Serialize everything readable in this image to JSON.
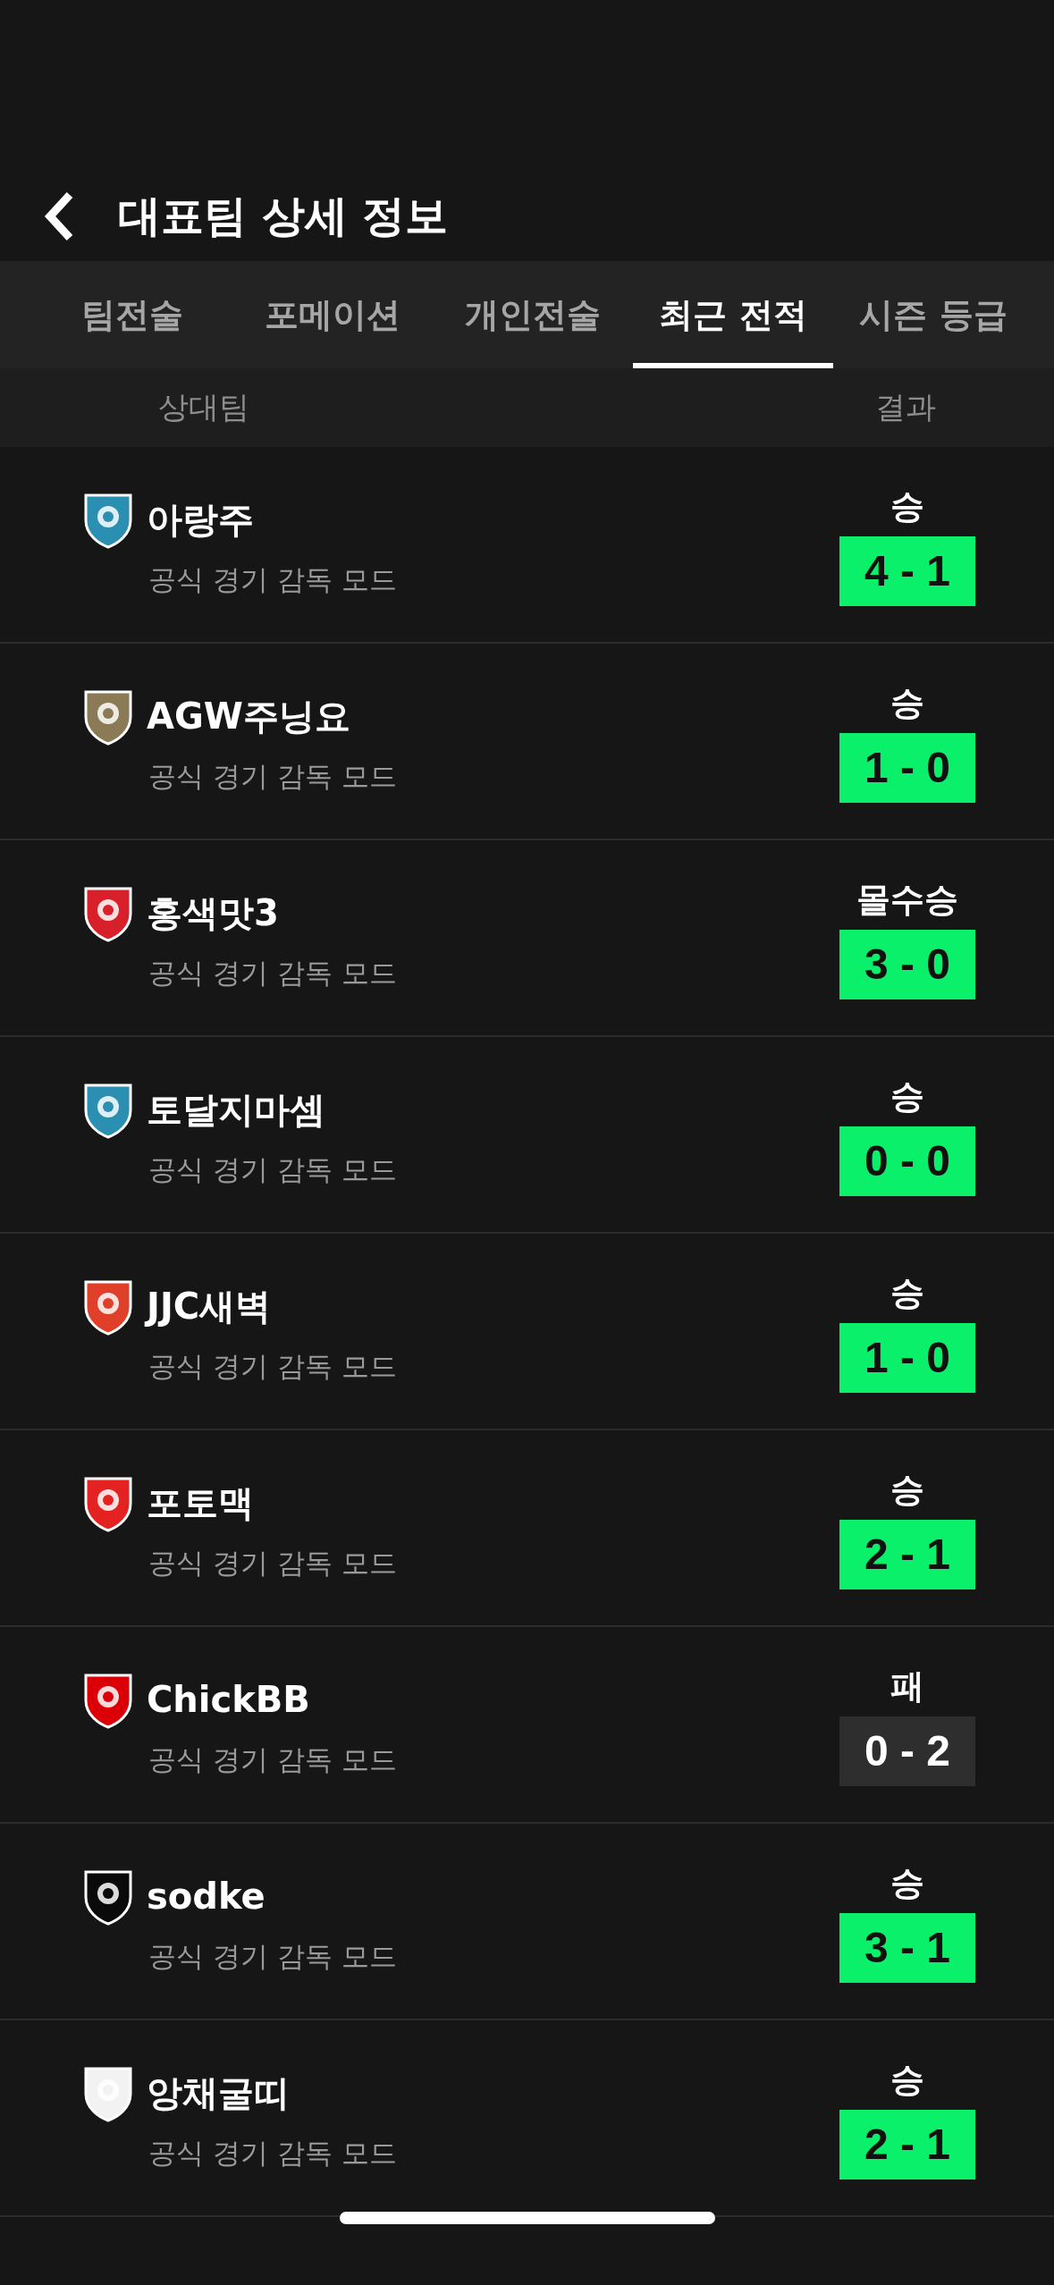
{
  "header": {
    "title": "대표팀 상세 정보"
  },
  "tabs": [
    {
      "label": "팀전술",
      "selected": false
    },
    {
      "label": "포메이션",
      "selected": false
    },
    {
      "label": "개인전술",
      "selected": false
    },
    {
      "label": "최근 전적",
      "selected": true
    },
    {
      "label": "시즌 등급",
      "selected": false
    }
  ],
  "columns": [
    "상대팀",
    "결과"
  ],
  "matches": [
    {
      "team": "아랑주",
      "mode": "공식 경기 감독 모드",
      "result": "승",
      "score": "4 - 1",
      "won": true,
      "color": "#2a8fb0"
    },
    {
      "team": "AGW주닝요",
      "mode": "공식 경기 감독 모드",
      "result": "승",
      "score": "1 - 0",
      "won": true,
      "color": "#8a7a55"
    },
    {
      "team": "홍색맛3",
      "mode": "공식 경기 감독 모드",
      "result": "몰수승",
      "score": "3 - 0",
      "won": true,
      "color": "#d8202a"
    },
    {
      "team": "토달지마셈",
      "mode": "공식 경기 감독 모드",
      "result": "승",
      "score": "0 - 0",
      "won": true,
      "color": "#2a8fb0"
    },
    {
      "team": "JJC새벽",
      "mode": "공식 경기 감독 모드",
      "result": "승",
      "score": "1 - 0",
      "won": true,
      "color": "#e0402a"
    },
    {
      "team": "포토맥",
      "mode": "공식 경기 감독 모드",
      "result": "승",
      "score": "2 - 1",
      "won": true,
      "color": "#e32221"
    },
    {
      "team": "ChickBB",
      "mode": "공식 경기 감독 모드",
      "result": "패",
      "score": "0 - 2",
      "won": false,
      "color": "#db0007"
    },
    {
      "team": "sodke",
      "mode": "공식 경기 감독 모드",
      "result": "승",
      "score": "3 - 1",
      "won": true,
      "color": "#0a0a0a"
    },
    {
      "team": "앙채굴띠",
      "mode": "공식 경기 감독 모드",
      "result": "승",
      "score": "2 - 1",
      "won": true,
      "color": "#f2f2f2"
    }
  ]
}
